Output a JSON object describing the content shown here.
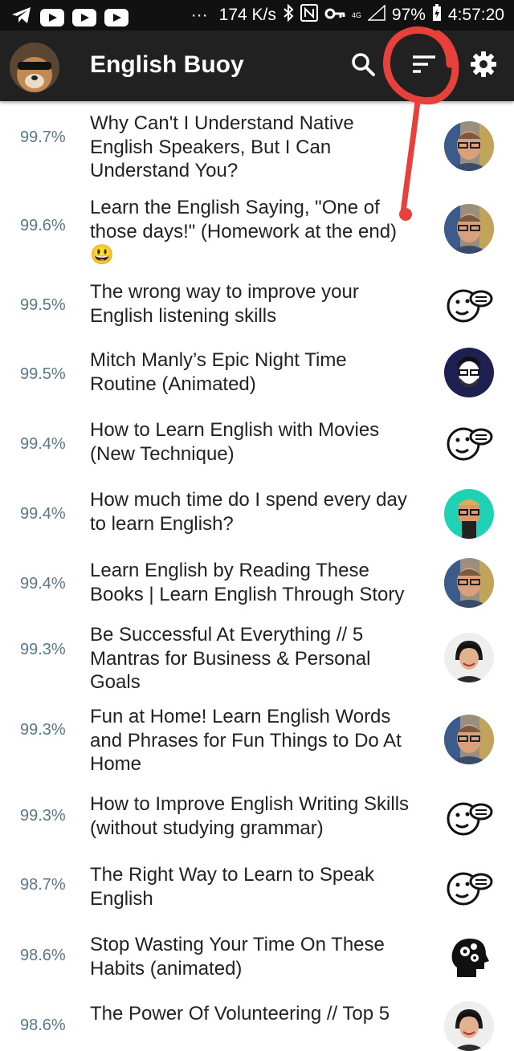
{
  "status_bar": {
    "speed": "174 K/s",
    "network": "4G",
    "battery": "97%",
    "time": "4:57:20"
  },
  "app_bar": {
    "title": "English Buoy",
    "icons": [
      "search-icon",
      "sort-icon",
      "gear-icon"
    ]
  },
  "items": [
    {
      "percent": "99.7%",
      "title": "Why Can't I Understand Native\nEnglish Speakers, But I Can\nUnderstand You?",
      "thumb": "man-glasses"
    },
    {
      "percent": "99.6%",
      "title": "Learn the English Saying, \"One of\nthose days!\" (Homework at the end)\n😃",
      "thumb": "man-glasses"
    },
    {
      "percent": "99.5%",
      "title": "The wrong way to improve your\nEnglish listening skills",
      "thumb": "talking-face"
    },
    {
      "percent": "99.5%",
      "title": "Mitch Manly’s Epic Night Time\nRoutine (Animated)",
      "thumb": "cartoon-man"
    },
    {
      "percent": "99.4%",
      "title": "How to Learn English with Movies\n(New Technique)",
      "thumb": "talking-face"
    },
    {
      "percent": "99.4%",
      "title": "How much time do I spend every day\nto learn English?",
      "thumb": "man-teal"
    },
    {
      "percent": "99.4%",
      "title": "Learn English by Reading These\nBooks | Learn English Through Story",
      "thumb": "man-glasses"
    },
    {
      "percent": "99.3%",
      "title": "Be Successful At Everything // 5\nMantras for Business & Personal\nGoals",
      "thumb": "woman"
    },
    {
      "percent": "99.3%",
      "title": "Fun at Home!  Learn English Words\nand Phrases for Fun Things to Do At\nHome",
      "thumb": "man-glasses"
    },
    {
      "percent": "99.3%",
      "title": "How to Improve English Writing Skills\n(without studying grammar)",
      "thumb": "talking-face"
    },
    {
      "percent": "98.7%",
      "title": "The Right Way to Learn to Speak\nEnglish",
      "thumb": "talking-face"
    },
    {
      "percent": "98.6%",
      "title": "Stop Wasting Your Time On These\nHabits (animated)",
      "thumb": "gears-head"
    },
    {
      "percent": "98.6%",
      "title": "The Power Of Volunteering // Top 5",
      "thumb": "woman"
    }
  ]
}
